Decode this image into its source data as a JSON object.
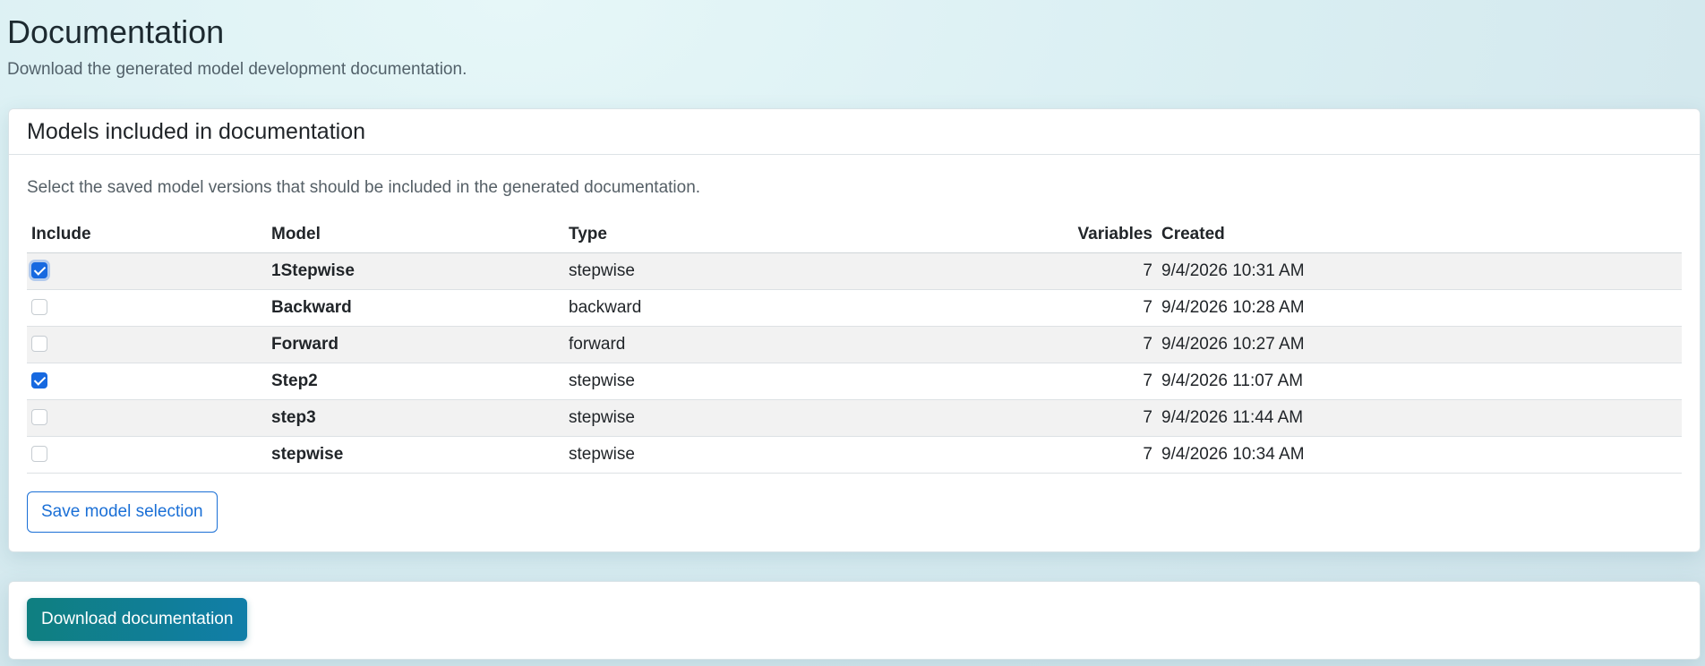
{
  "page": {
    "title": "Documentation",
    "subtitle": "Download the generated model development documentation."
  },
  "models_card": {
    "header": "Models included in documentation",
    "help_text": "Select the saved model versions that should be included in the generated documentation.",
    "columns": {
      "include": "Include",
      "model": "Model",
      "type": "Type",
      "variables": "Variables",
      "created": "Created"
    },
    "rows": [
      {
        "included": true,
        "model": "1Stepwise",
        "type": "stepwise",
        "variables": "7",
        "created": "9/4/2026 10:31 AM"
      },
      {
        "included": false,
        "model": "Backward",
        "type": "backward",
        "variables": "7",
        "created": "9/4/2026 10:28 AM"
      },
      {
        "included": false,
        "model": "Forward",
        "type": "forward",
        "variables": "7",
        "created": "9/4/2026 10:27 AM"
      },
      {
        "included": true,
        "model": "Step2",
        "type": "stepwise",
        "variables": "7",
        "created": "9/4/2026 11:07 AM"
      },
      {
        "included": false,
        "model": "step3",
        "type": "stepwise",
        "variables": "7",
        "created": "9/4/2026 11:44 AM"
      },
      {
        "included": false,
        "model": "stepwise",
        "type": "stepwise",
        "variables": "7",
        "created": "9/4/2026 10:34 AM"
      }
    ],
    "save_button": "Save model selection"
  },
  "download_card": {
    "button": "Download documentation"
  },
  "colors": {
    "accent": "#1769e0",
    "primary_button_start": "#0f7f80",
    "primary_button_end": "#117ea8"
  }
}
